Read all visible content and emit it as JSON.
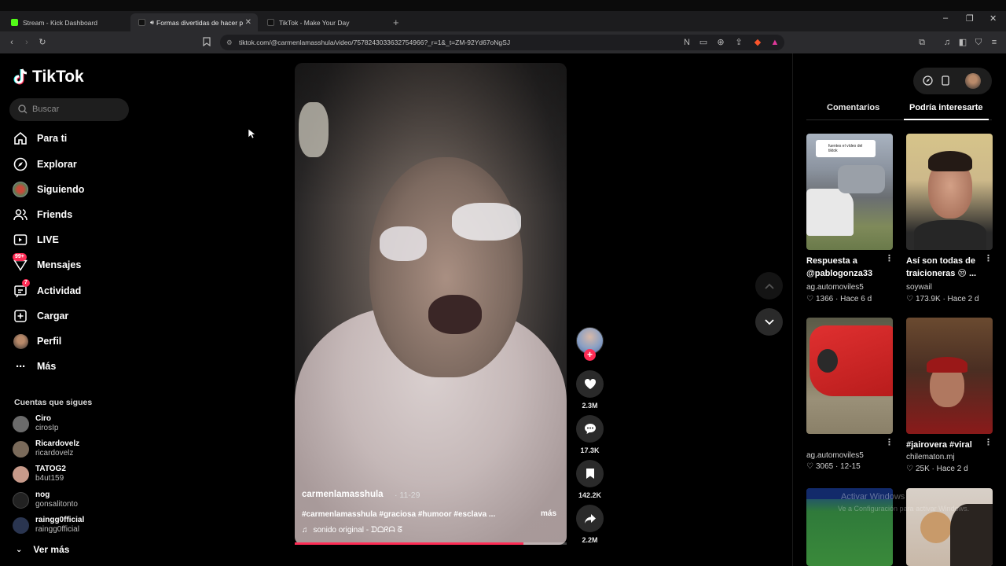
{
  "browser": {
    "tabs": [
      {
        "label": "Stream - Kick Dashboard",
        "favicon_color": "#53fc18",
        "active": false
      },
      {
        "label": "Formas divertidas de hacer p",
        "favicon_color": "#ffffff",
        "active": true
      },
      {
        "label": "TikTok - Make Your Day",
        "favicon_color": "#ffffff",
        "active": false
      }
    ],
    "new_tab": "+",
    "url": "tiktok.com/@carmenlamasshula/video/7578243033632754966?_r=1&_t=ZM-92Yd67oNgSJ",
    "window_controls": [
      "–",
      "❐",
      "✕"
    ]
  },
  "sidebar": {
    "logo_text": "TikTok",
    "search_placeholder": "Buscar",
    "nav": [
      {
        "label": "Para ti",
        "icon": "home-icon"
      },
      {
        "label": "Explorar",
        "icon": "compass-icon"
      },
      {
        "label": "Siguiendo",
        "icon": "following-avatar-icon"
      },
      {
        "label": "Friends",
        "icon": "friends-icon"
      },
      {
        "label": "LIVE",
        "icon": "live-icon"
      },
      {
        "label": "Mensajes",
        "icon": "messages-icon",
        "badge": "99+"
      },
      {
        "label": "Actividad",
        "icon": "activity-icon",
        "badge": "7"
      },
      {
        "label": "Cargar",
        "icon": "upload-icon"
      },
      {
        "label": "Perfil",
        "icon": "profile-avatar-icon"
      },
      {
        "label": "Más",
        "icon": "more-dots-icon"
      }
    ],
    "following_title": "Cuentas que sigues",
    "following": [
      {
        "name": "Ciro",
        "handle": "cirosIp",
        "color": "#6b6b6b"
      },
      {
        "name": "Ricardovelz",
        "handle": "ricardovelz",
        "color": "#7a6a5a"
      },
      {
        "name": "TATOG2",
        "handle": "b4ut159",
        "color": "#c79a8a"
      },
      {
        "name": "nog",
        "handle": "gonsalitonto",
        "color": "#222222"
      },
      {
        "name": "raingg0fficial",
        "handle": "raingg0fficial",
        "color": "#2a3550"
      }
    ],
    "see_more": "Ver más"
  },
  "video": {
    "username": "carmenlamasshula",
    "date": "· 11-29",
    "caption": "#carmenlamasshula #graciosa #humoor #esclava ...",
    "more": "más",
    "sound": "sonido original - ᗪᗝᖇᗩ ᘔ",
    "progress": 0.84
  },
  "actions": {
    "likes": "2.3M",
    "comments": "17.3K",
    "saves": "142.2K",
    "shares": "2.2M"
  },
  "right_panel": {
    "tabs": [
      "Comentarios",
      "Podría interesarte"
    ],
    "active_tab": 1,
    "cards": [
      {
        "title": "Respuesta a @pablogonza33",
        "user": "ag.automoviles5",
        "meta": "1366 · Hace 6 d"
      },
      {
        "title": "Así son todas de traicioneras 😒 ...",
        "user": "soywail",
        "meta": "173.9K · Hace 2 d"
      },
      {
        "title": "",
        "user": "ag.automoviles5",
        "meta": "3065 · 12-15"
      },
      {
        "title": "#jairovera #viral",
        "user": "chilematon.mj",
        "meta": "25K · Hace 2 d"
      }
    ],
    "thumb_caption": "fuentes el vídeo del tiktok",
    "overlay_text": "Activar Windows",
    "overlay_sub": "Ve a Configuración para activar Windows."
  },
  "colors": {
    "accent": "#fe2c55",
    "bg": "#000000",
    "panel": "#1e1e1e"
  }
}
